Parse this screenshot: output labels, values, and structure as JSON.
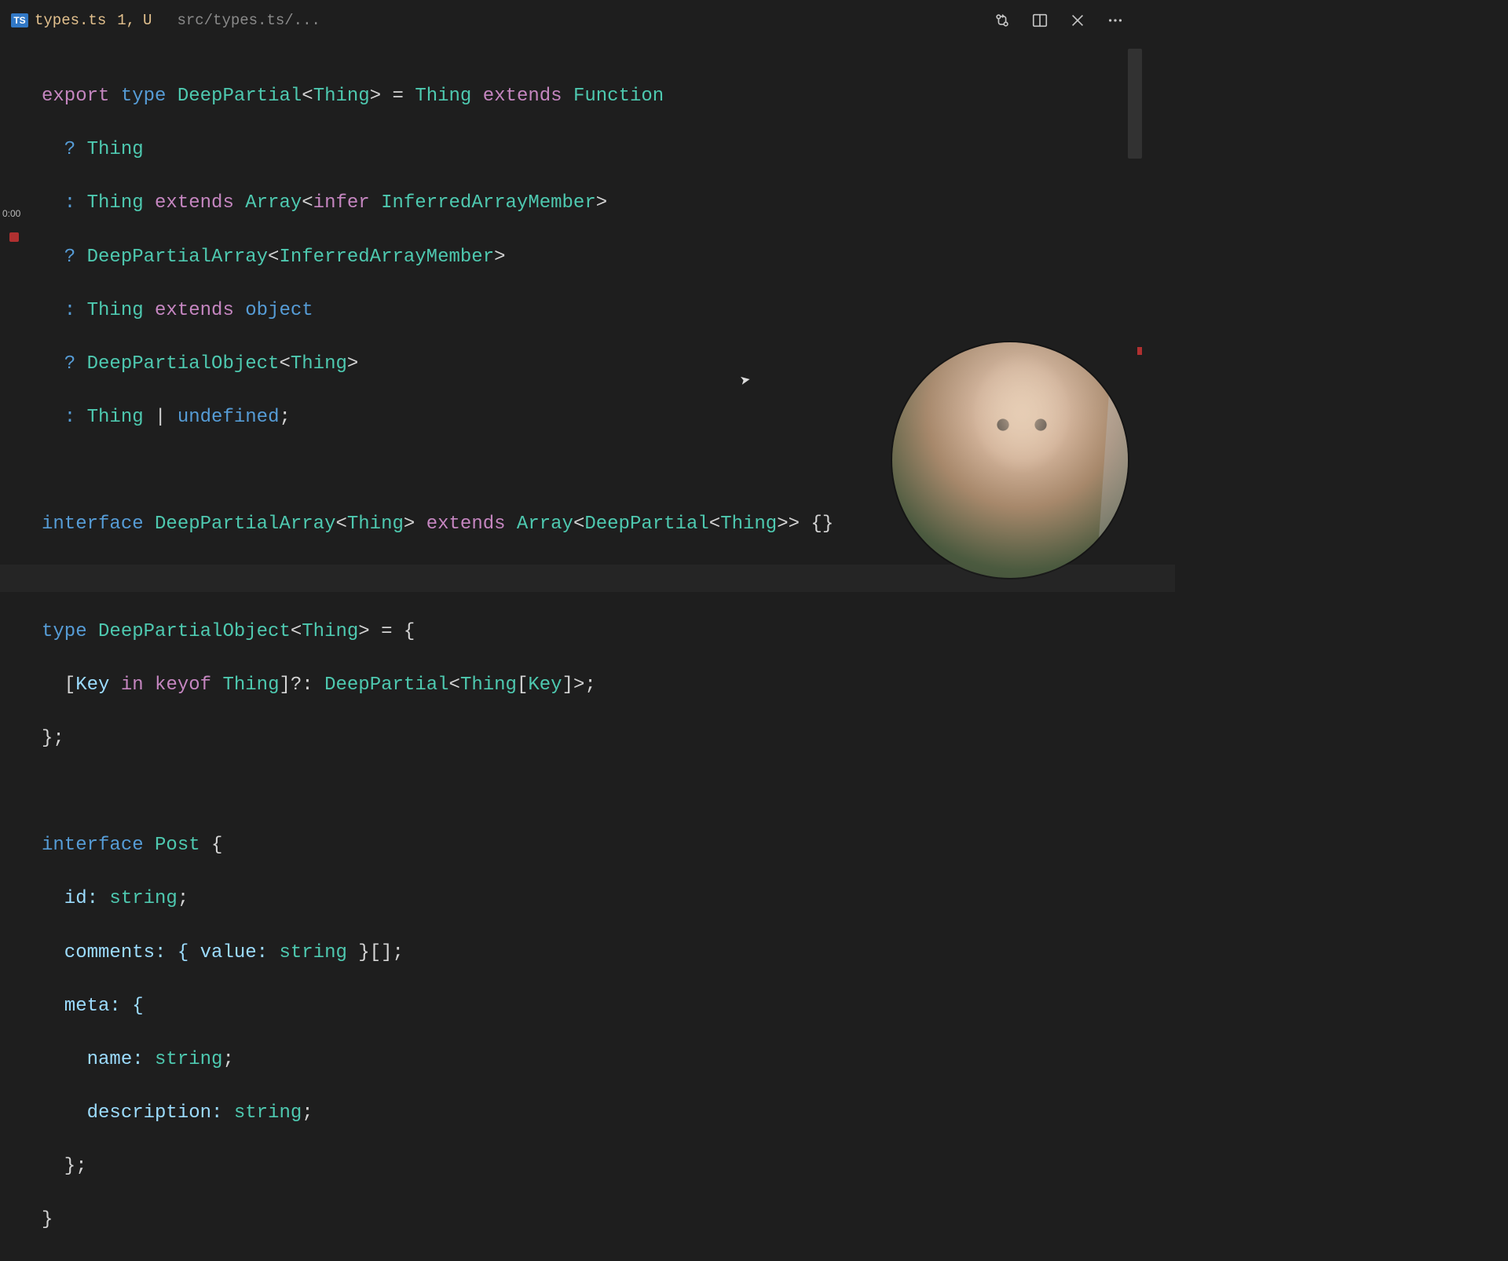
{
  "tab": {
    "lang_badge": "TS",
    "filename": "types.ts",
    "mod_count": "1,",
    "status": "U",
    "breadcrumb": "src/types.ts/..."
  },
  "overlay": {
    "rec_time": "0:00"
  },
  "code": {
    "l1": {
      "a": "export ",
      "b": "type ",
      "c": "DeepPartial",
      "d": "<",
      "e": "Thing",
      "f": "> = ",
      "g": "Thing ",
      "h": "extends ",
      "i": "Function"
    },
    "l2": {
      "a": "  ? ",
      "b": "Thing"
    },
    "l3": {
      "a": "  : ",
      "b": "Thing ",
      "c": "extends ",
      "d": "Array",
      "e": "<",
      "f": "infer ",
      "g": "InferredArrayMember",
      "h": ">"
    },
    "l4": {
      "a": "  ? ",
      "b": "DeepPartialArray",
      "c": "<",
      "d": "InferredArrayMember",
      "e": ">"
    },
    "l5": {
      "a": "  : ",
      "b": "Thing ",
      "c": "extends ",
      "d": "object"
    },
    "l6": {
      "a": "  ? ",
      "b": "DeepPartialObject",
      "c": "<",
      "d": "Thing",
      "e": ">"
    },
    "l7": {
      "a": "  : ",
      "b": "Thing ",
      "c": "| ",
      "d": "undefined",
      "e": ";"
    },
    "l8": {
      "a": ""
    },
    "l9": {
      "a": "interface ",
      "b": "DeepPartialArray",
      "c": "<",
      "d": "Thing",
      "e": "> ",
      "f": "extends ",
      "g": "Array",
      "h": "<",
      "i": "DeepPartial",
      "j": "<",
      "k": "Thing",
      "l": ">> {}"
    },
    "l10": {
      "a": ""
    },
    "l11": {
      "a": "type ",
      "b": "DeepPartialObject",
      "c": "<",
      "d": "Thing",
      "e": "> = {"
    },
    "l12": {
      "a": "  [",
      "b": "Key ",
      "c": "in ",
      "d": "keyof ",
      "e": "Thing",
      "f": "]?: ",
      "g": "DeepPartial",
      "h": "<",
      "i": "Thing",
      "j": "[",
      "k": "Key",
      "l": "]>;"
    },
    "l13": {
      "a": "};"
    },
    "l14": {
      "a": ""
    },
    "l15": {
      "a": "interface ",
      "b": "Post ",
      "c": "{"
    },
    "l16": {
      "a": "  id: ",
      "b": "string",
      "c": ";"
    },
    "l17": {
      "a": "  comments: { value: ",
      "b": "string ",
      "c": "}[];"
    },
    "l18": {
      "a": "  meta: {"
    },
    "l19": {
      "a": "    name: ",
      "b": "string",
      "c": ";"
    },
    "l20": {
      "a": "    description: ",
      "b": "string",
      "c": ";"
    },
    "l21": {
      "a": "  };"
    },
    "l22": {
      "a": "}"
    }
  }
}
